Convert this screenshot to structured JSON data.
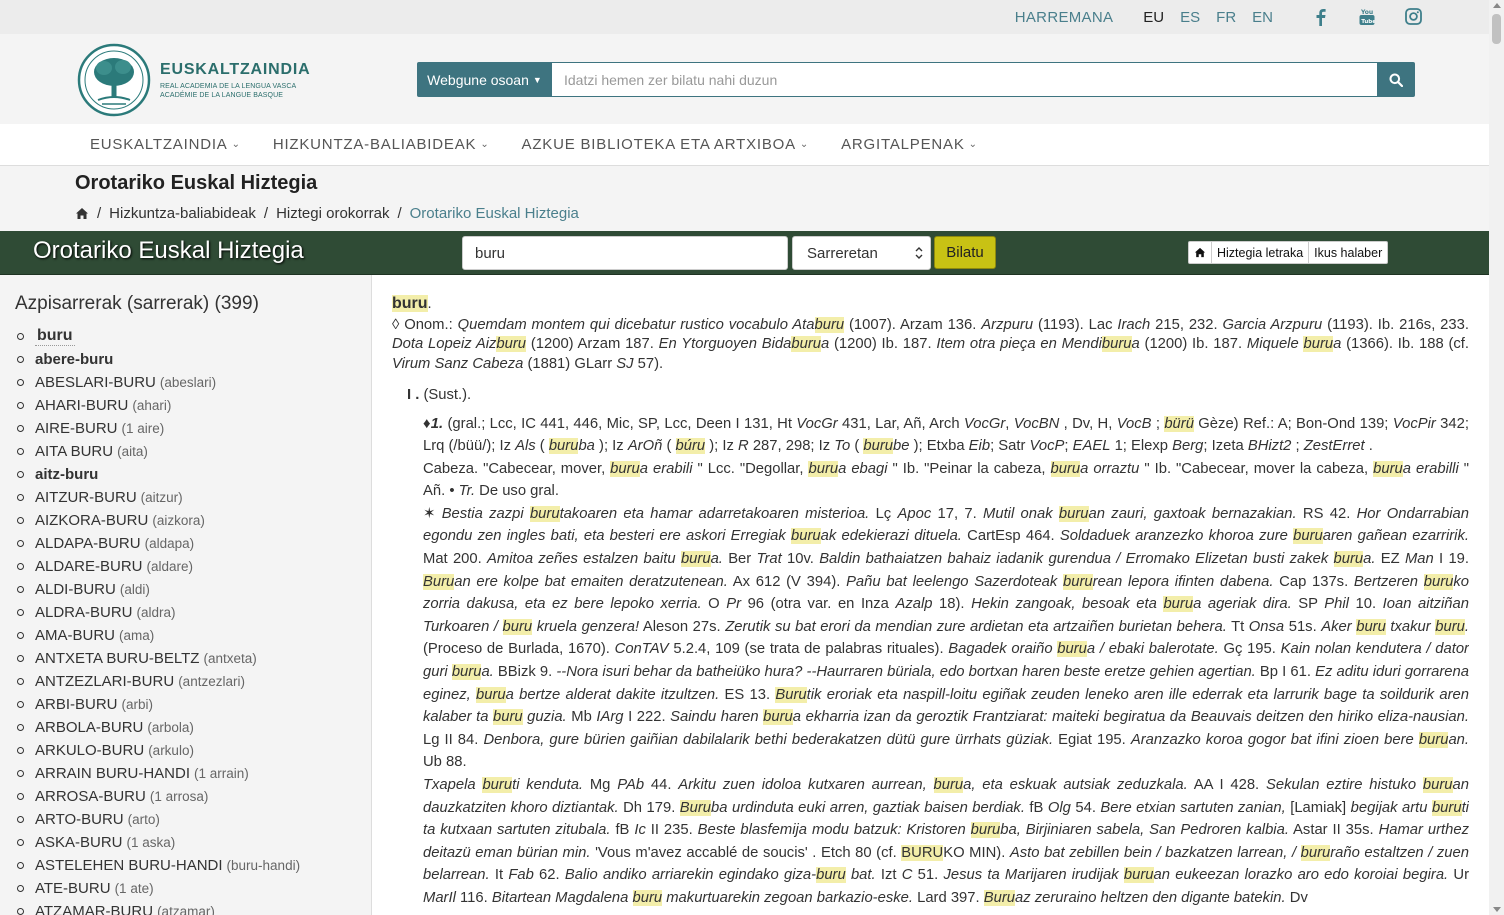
{
  "topbar": {
    "contact": "HARREMANA",
    "languages": [
      "EU",
      "ES",
      "FR",
      "EN"
    ],
    "active_language": "EU"
  },
  "logo": {
    "name": "EUSKALTZAINDIA",
    "sub1": "REAL ACADEMIA DE LA LENGUA VASCA",
    "sub2": "ACADÉMIE DE LA LANGUE BASQUE"
  },
  "search": {
    "scope_label": "Webgune osoan",
    "placeholder": "Idatzi hemen zer bilatu nahi duzun"
  },
  "nav": [
    "EUSKALTZAINDIA",
    "HIZKUNTZA-BALIABIDEAK",
    "AZKUE BIBLIOTEKA ETA ARTXIBOA",
    "ARGITALPENAK"
  ],
  "page_title": "Orotariko Euskal Hiztegia",
  "breadcrumb": [
    "Hizkuntza-baliabideak",
    "Hiztegi orokorrak",
    "Orotariko Euskal Hiztegia"
  ],
  "dictbar": {
    "title": "Orotariko Euskal Hiztegia",
    "query": "buru",
    "mode": "Sarreretan",
    "submit": "Bilatu",
    "link1": "Hiztegia letraka",
    "link2": "Ikus halaber"
  },
  "sidebar": {
    "heading": "Azpisarrerak (sarrerak) (399)",
    "items": [
      {
        "hw": "buru",
        "ref": "",
        "style": "first"
      },
      {
        "hw": "abere-buru",
        "ref": "",
        "style": "bold"
      },
      {
        "hw": "ABESLARI-BURU",
        "ref": "(abeslari)",
        "style": ""
      },
      {
        "hw": "AHARI-BURU",
        "ref": "(ahari)",
        "style": ""
      },
      {
        "hw": "AIRE-BURU",
        "ref": "(1 aire)",
        "style": ""
      },
      {
        "hw": "AITA BURU",
        "ref": "(aita)",
        "style": ""
      },
      {
        "hw": "aitz-buru",
        "ref": "",
        "style": "bold"
      },
      {
        "hw": "AITZUR-BURU",
        "ref": "(aitzur)",
        "style": ""
      },
      {
        "hw": "AIZKORA-BURU",
        "ref": "(aizkora)",
        "style": ""
      },
      {
        "hw": "ALDAPA-BURU",
        "ref": "(aldapa)",
        "style": ""
      },
      {
        "hw": "ALDARE-BURU",
        "ref": "(aldare)",
        "style": ""
      },
      {
        "hw": "ALDI-BURU",
        "ref": "(aldi)",
        "style": ""
      },
      {
        "hw": "ALDRA-BURU",
        "ref": "(aldra)",
        "style": ""
      },
      {
        "hw": "AMA-BURU",
        "ref": "(ama)",
        "style": ""
      },
      {
        "hw": "ANTXETA BURU-BELTZ",
        "ref": "(antxeta)",
        "style": ""
      },
      {
        "hw": "ANTZEZLARI-BURU",
        "ref": "(antzezlari)",
        "style": ""
      },
      {
        "hw": "ARBI-BURU",
        "ref": "(arbi)",
        "style": ""
      },
      {
        "hw": "ARBOLA-BURU",
        "ref": "(arbola)",
        "style": ""
      },
      {
        "hw": "ARKULO-BURU",
        "ref": "(arkulo)",
        "style": ""
      },
      {
        "hw": "ARRAIN BURU-HANDI",
        "ref": "(1 arrain)",
        "style": ""
      },
      {
        "hw": "ARROSA-BURU",
        "ref": "(1 arrosa)",
        "style": ""
      },
      {
        "hw": "ARTO-BURU",
        "ref": "(arto)",
        "style": ""
      },
      {
        "hw": "ASKA-BURU",
        "ref": "(1 aska)",
        "style": ""
      },
      {
        "hw": "ASTELEHEN BURU-HANDI",
        "ref": "(buru-handi)",
        "style": ""
      },
      {
        "hw": "ATE-BURU",
        "ref": "(1 ate)",
        "style": ""
      },
      {
        "hw": "ATZAMAR-BURU",
        "ref": "(atzamar)",
        "style": ""
      }
    ]
  },
  "entry": {
    "lemma": "buru",
    "section_label": "I .",
    "section_pos": "(Sust.)."
  }
}
